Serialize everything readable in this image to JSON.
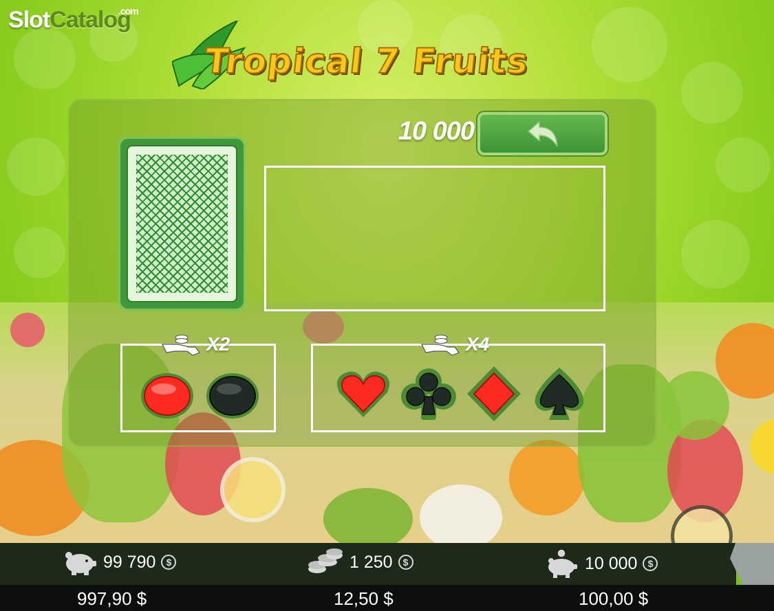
{
  "site_logo": {
    "slot": "Slot",
    "catalog": "Catalog",
    "com": ".com"
  },
  "game": {
    "title": "Tropical 7 Fruits"
  },
  "gamble": {
    "bet_amount": "10 000",
    "back_button_icon": "undo-arrow-icon",
    "color_group": {
      "multiplier": "X2",
      "options": [
        "red",
        "black"
      ]
    },
    "suit_group": {
      "multiplier": "X4",
      "options": [
        "hearts",
        "clubs",
        "diamonds",
        "spades"
      ]
    }
  },
  "status": {
    "balance": {
      "credits": "99 790",
      "money": "997,90 $",
      "icon": "piggy-bank-icon"
    },
    "bet": {
      "credits": "1 250",
      "money": "12,50 $",
      "icon": "chips-stack-icon"
    },
    "win": {
      "credits": "10 000",
      "money": "100,00 $",
      "icon": "piggy-bank-coin-icon"
    },
    "coin_symbol": "$"
  },
  "colors": {
    "red": "#ff2a1f",
    "black": "#1f2b24",
    "panel_green": "#3e9a38"
  }
}
